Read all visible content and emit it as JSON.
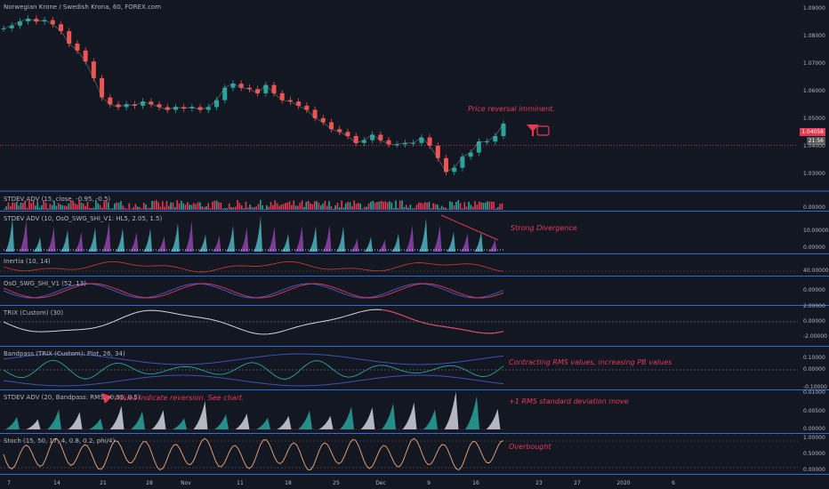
{
  "window": {
    "symbol_title": "Norwegian Krone / Swedish Krona, 60, FOREX.com",
    "theme_colors": {
      "background": "#131722",
      "panel_border": "#2a6fd6",
      "annotation": "#e53955",
      "text": "#b2b5be"
    }
  },
  "price": {
    "current_badge": "1.04058",
    "countdown_badge": "21:56",
    "axis_ticks": [
      "1.09000",
      "1.08000",
      "1.07000",
      "1.06000",
      "1.05000",
      "1.04000",
      "1.03000"
    ]
  },
  "x_axis": {
    "ticks": [
      "7",
      "14",
      "21",
      "28",
      "Nov",
      "11",
      "18",
      "25",
      "Dec",
      "9",
      "16",
      "23",
      "27",
      "2020",
      "6"
    ]
  },
  "panels": [
    {
      "id": "stdev1",
      "label": "STDEV ADV (15, close, -0.95, -0.5)",
      "axis": [
        "0.00000"
      ]
    },
    {
      "id": "stdev2",
      "label": "STDEV ADV (10, OsO_SWG_SHI_V1: HL5, 2.05, 1.5)",
      "axis": [
        "10.00000",
        "0.00000"
      ]
    },
    {
      "id": "inertia",
      "label": "Inertia (10, 14)",
      "axis": [
        "40.00000"
      ]
    },
    {
      "id": "oso",
      "label": "OsO_SWG_SHI_V1 (52, 13)",
      "axis": [
        "0.00000"
      ]
    },
    {
      "id": "trix",
      "label": "TRIX (Custom) (30)",
      "axis": [
        "2.00000",
        "0.00000",
        "-2.00000"
      ]
    },
    {
      "id": "bandpass",
      "label": "Bandpass (TRIX (Custom): Plot, 26, 34)",
      "axis": [
        "0.10000",
        "0.00000",
        "-0.10000"
      ]
    },
    {
      "id": "stdev3",
      "label": "STDEV ADV (20, Bandpass: RMS, -0.95, 0.5)",
      "axis": [
        "0.01000",
        "0.00500",
        "0.00000"
      ]
    },
    {
      "id": "stoch",
      "label": "Stoch (15, 50, 17, 4, 0.8, 0.2, phi/4)",
      "axis": [
        "1.00000",
        "0.50000",
        "0.00000"
      ]
    }
  ],
  "annotations": {
    "price_reversal": "Price reversal imminent.",
    "strong_divergence": "Strong Divergence",
    "contracting_rms": "Contracting RMS values, increasing PB values",
    "values_reversion": "values indicate reversion. See chart.",
    "rms_stdev": "+1 RMS standard deviation move",
    "overbought": "Overbought"
  },
  "chart_data": {
    "type": "line",
    "title": "Norwegian Krone / Swedish Krona, 60, FOREX.com",
    "xlabel": "",
    "ylabel": "",
    "ylim": [
      1.025,
      1.092
    ],
    "x_ticks": [
      "7",
      "14",
      "21",
      "28",
      "Nov",
      "11",
      "18",
      "25",
      "Dec",
      "9",
      "16",
      "23",
      "27",
      "2020",
      "6"
    ],
    "series": [
      {
        "values": [
          1.083,
          1.084,
          1.0855,
          1.0865,
          1.0855,
          1.086,
          1.0845,
          1.082,
          1.0775,
          1.075,
          1.071,
          1.065,
          1.058,
          1.0555,
          1.0545,
          1.0555,
          1.055,
          1.0565,
          1.0555,
          1.0545,
          1.0535,
          1.0545,
          1.054,
          1.0545,
          1.0535,
          1.0545,
          1.057,
          1.0615,
          1.063,
          1.0615,
          1.061,
          1.0595,
          1.0625,
          1.0595,
          1.057,
          1.0565,
          1.055,
          1.0535,
          1.0505,
          1.049,
          1.0465,
          1.0455,
          1.044,
          1.0415,
          1.0425,
          1.0445,
          1.0425,
          1.041,
          1.041,
          1.0415,
          1.0415,
          1.0435,
          1.0405,
          1.036,
          1.031,
          1.0325,
          1.0365,
          1.038,
          1.042,
          1.042,
          1.044,
          1.0485
        ]
      }
    ],
    "current_price": 1.04058,
    "reference_line": 1.04058
  }
}
